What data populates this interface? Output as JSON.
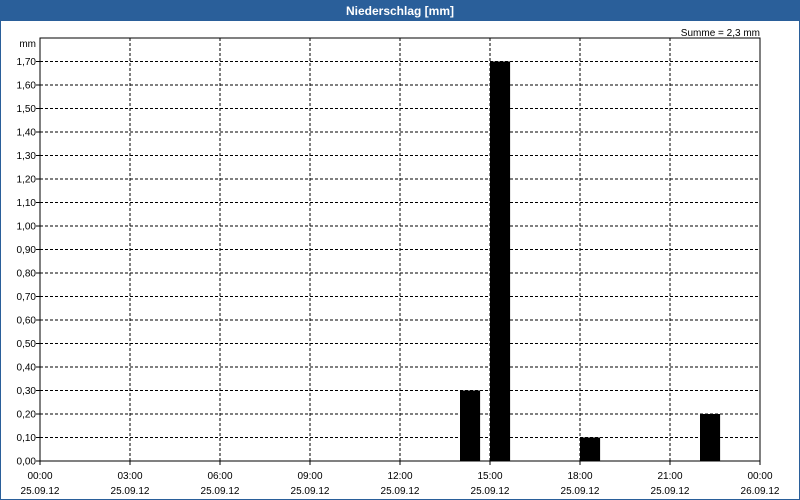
{
  "window": {
    "title": "Niederschlag [mm]"
  },
  "colors": {
    "titlebar": "#2a5f9a",
    "bar": "#000000",
    "grid": "#000000"
  },
  "chart_data": {
    "type": "bar",
    "title": "Niederschlag [mm]",
    "ylabel": "mm",
    "annotation": "Summe = 2,3 mm",
    "ylim": [
      0,
      1.8
    ],
    "y_ticks": [
      "0,00",
      "0,10",
      "0,20",
      "0,30",
      "0,40",
      "0,50",
      "0,60",
      "0,70",
      "0,80",
      "0,90",
      "1,00",
      "1,10",
      "1,20",
      "1,30",
      "1,40",
      "1,50",
      "1,60",
      "1,70"
    ],
    "y_tick_values": [
      0,
      0.1,
      0.2,
      0.3,
      0.4,
      0.5,
      0.6,
      0.7,
      0.8,
      0.9,
      1.0,
      1.1,
      1.2,
      1.3,
      1.4,
      1.5,
      1.6,
      1.7
    ],
    "x_range_hours": [
      0,
      24
    ],
    "x_ticks": [
      {
        "hour": 0,
        "time": "00:00",
        "date": "25.09.12"
      },
      {
        "hour": 3,
        "time": "03:00",
        "date": "25.09.12"
      },
      {
        "hour": 6,
        "time": "06:00",
        "date": "25.09.12"
      },
      {
        "hour": 9,
        "time": "09:00",
        "date": "25.09.12"
      },
      {
        "hour": 12,
        "time": "12:00",
        "date": "25.09.12"
      },
      {
        "hour": 15,
        "time": "15:00",
        "date": "25.09.12"
      },
      {
        "hour": 18,
        "time": "18:00",
        "date": "25.09.12"
      },
      {
        "hour": 21,
        "time": "21:00",
        "date": "25.09.12"
      },
      {
        "hour": 24,
        "time": "00:00",
        "date": "26.09.12"
      }
    ],
    "bars": [
      {
        "start_hour": 14.0,
        "end_hour": 14.67,
        "value": 0.3
      },
      {
        "start_hour": 15.0,
        "end_hour": 15.67,
        "value": 1.7
      },
      {
        "start_hour": 18.0,
        "end_hour": 18.67,
        "value": 0.1
      },
      {
        "start_hour": 22.0,
        "end_hour": 22.67,
        "value": 0.2
      }
    ],
    "grid": true
  }
}
